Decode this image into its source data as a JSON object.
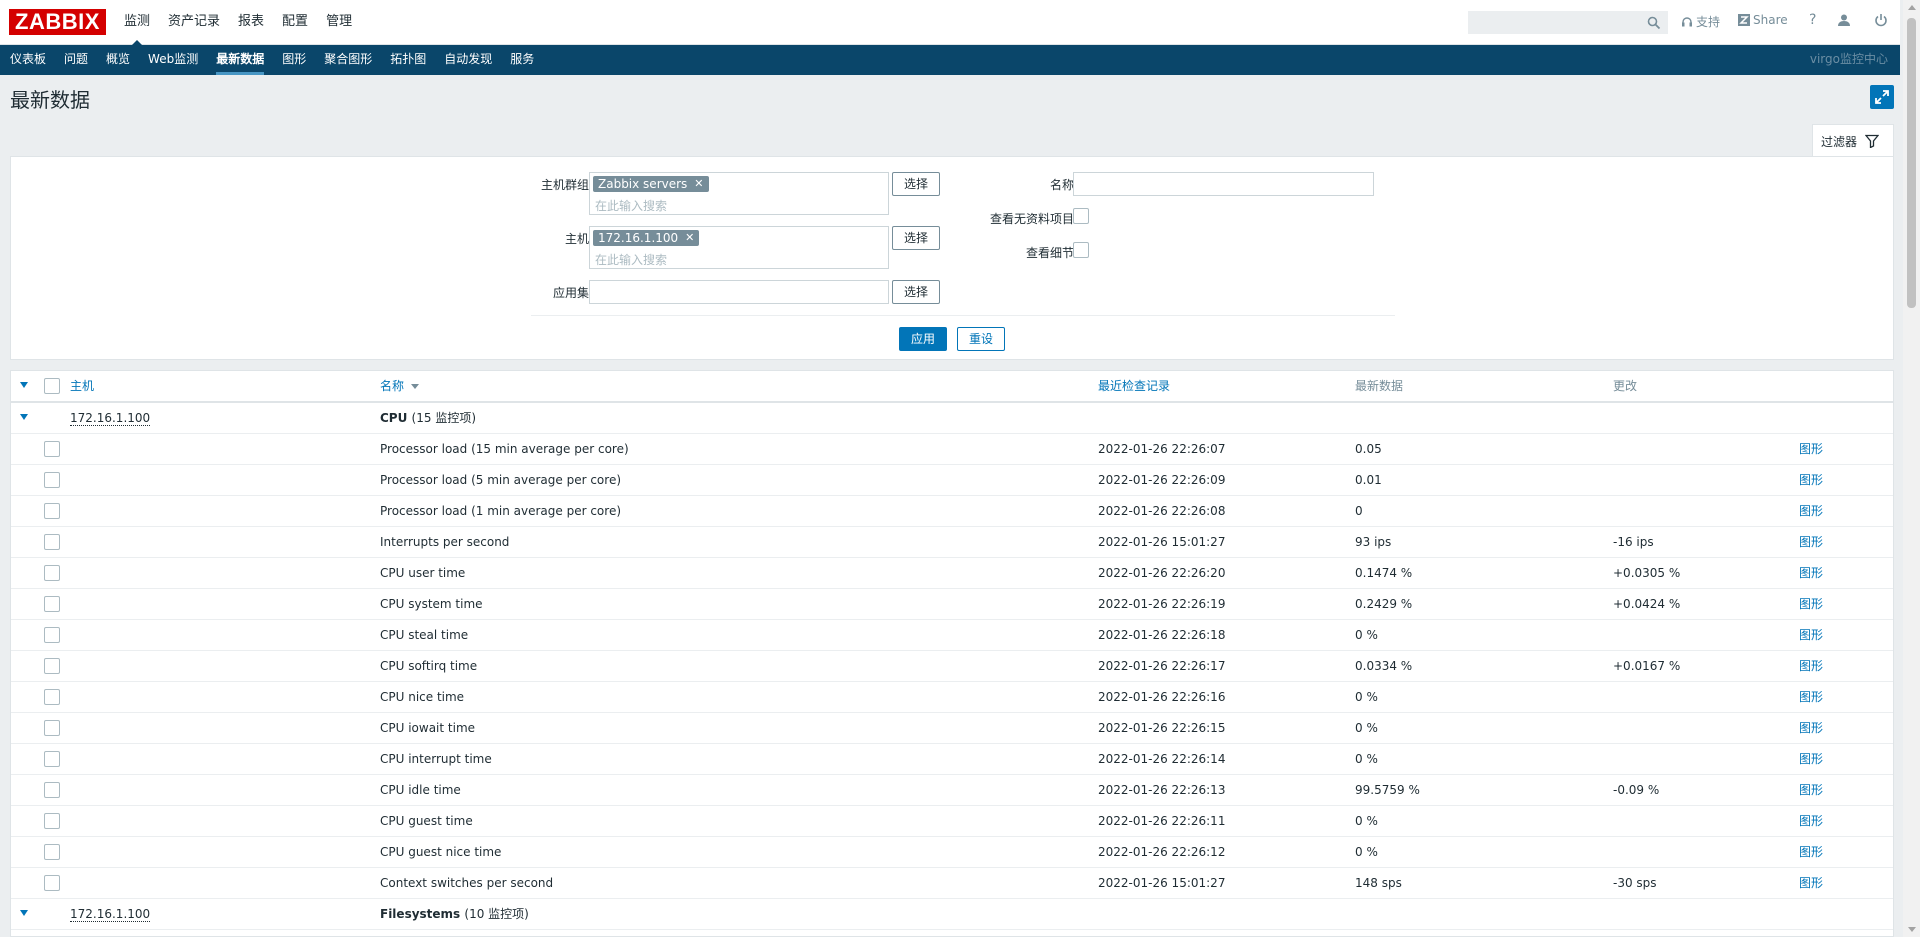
{
  "logo": "ZABBIX",
  "top_menu": [
    {
      "label": "监测",
      "selected": true
    },
    {
      "label": "资产记录",
      "selected": false
    },
    {
      "label": "报表",
      "selected": false
    },
    {
      "label": "配置",
      "selected": false
    },
    {
      "label": "管理",
      "selected": false
    }
  ],
  "header_right": {
    "search_placeholder": "",
    "support_label": "支持",
    "share_label": "Share",
    "help_label": "?"
  },
  "sub_menu": [
    {
      "label": "仪表板",
      "selected": false
    },
    {
      "label": "问题",
      "selected": false
    },
    {
      "label": "概览",
      "selected": false
    },
    {
      "label": "Web监测",
      "selected": false
    },
    {
      "label": "最新数据",
      "selected": true
    },
    {
      "label": "图形",
      "selected": false
    },
    {
      "label": "聚合图形",
      "selected": false
    },
    {
      "label": "拓扑图",
      "selected": false
    },
    {
      "label": "自动发现",
      "selected": false
    },
    {
      "label": "服务",
      "selected": false
    }
  ],
  "server_name": "virgo监控中心",
  "page_title": "最新数据",
  "filter": {
    "tab_label": "过滤器",
    "host_group_label": "主机群组",
    "host_group_tag": "Zabbix servers",
    "host_label": "主机",
    "host_tag": "172.16.1.100",
    "search_placeholder": "在此输入搜索",
    "app_label": "应用集",
    "app_value": "",
    "select_label": "选择",
    "name_label": "名称",
    "name_value": "",
    "show_without_data_label": "查看无资料项目",
    "show_details_label": "查看细节",
    "apply_label": "应用",
    "reset_label": "重设"
  },
  "table": {
    "columns": {
      "host": "主机",
      "name": "名称",
      "last_check": "最近检查记录",
      "last_value": "最新数据",
      "change": "更改"
    },
    "graph_label": "图形",
    "groups": [
      {
        "host": "172.16.1.100",
        "app": "CPU",
        "count": "(15 监控项)",
        "items": [
          {
            "name": "Processor load (15 min average per core)",
            "last_check": "2022-01-26 22:26:07",
            "value": "0.05",
            "change": ""
          },
          {
            "name": "Processor load (5 min average per core)",
            "last_check": "2022-01-26 22:26:09",
            "value": "0.01",
            "change": ""
          },
          {
            "name": "Processor load (1 min average per core)",
            "last_check": "2022-01-26 22:26:08",
            "value": "0",
            "change": ""
          },
          {
            "name": "Interrupts per second",
            "last_check": "2022-01-26 15:01:27",
            "value": "93 ips",
            "change": "-16 ips"
          },
          {
            "name": "CPU user time",
            "last_check": "2022-01-26 22:26:20",
            "value": "0.1474 %",
            "change": "+0.0305 %"
          },
          {
            "name": "CPU system time",
            "last_check": "2022-01-26 22:26:19",
            "value": "0.2429 %",
            "change": "+0.0424 %"
          },
          {
            "name": "CPU steal time",
            "last_check": "2022-01-26 22:26:18",
            "value": "0 %",
            "change": ""
          },
          {
            "name": "CPU softirq time",
            "last_check": "2022-01-26 22:26:17",
            "value": "0.0334 %",
            "change": "+0.0167 %"
          },
          {
            "name": "CPU nice time",
            "last_check": "2022-01-26 22:26:16",
            "value": "0 %",
            "change": ""
          },
          {
            "name": "CPU iowait time",
            "last_check": "2022-01-26 22:26:15",
            "value": "0 %",
            "change": ""
          },
          {
            "name": "CPU interrupt time",
            "last_check": "2022-01-26 22:26:14",
            "value": "0 %",
            "change": ""
          },
          {
            "name": "CPU idle time",
            "last_check": "2022-01-26 22:26:13",
            "value": "99.5759 %",
            "change": "-0.09 %"
          },
          {
            "name": "CPU guest time",
            "last_check": "2022-01-26 22:26:11",
            "value": "0 %",
            "change": ""
          },
          {
            "name": "CPU guest nice time",
            "last_check": "2022-01-26 22:26:12",
            "value": "0 %",
            "change": ""
          },
          {
            "name": "Context switches per second",
            "last_check": "2022-01-26 15:01:27",
            "value": "148 sps",
            "change": "-30 sps"
          }
        ]
      },
      {
        "host": "172.16.1.100",
        "app": "Filesystems",
        "count": "(10 监控项)",
        "items": []
      }
    ]
  },
  "colors": {
    "brand_red": "#d40000",
    "nav_blue": "#0a466a",
    "link_blue": "#0275b8"
  }
}
